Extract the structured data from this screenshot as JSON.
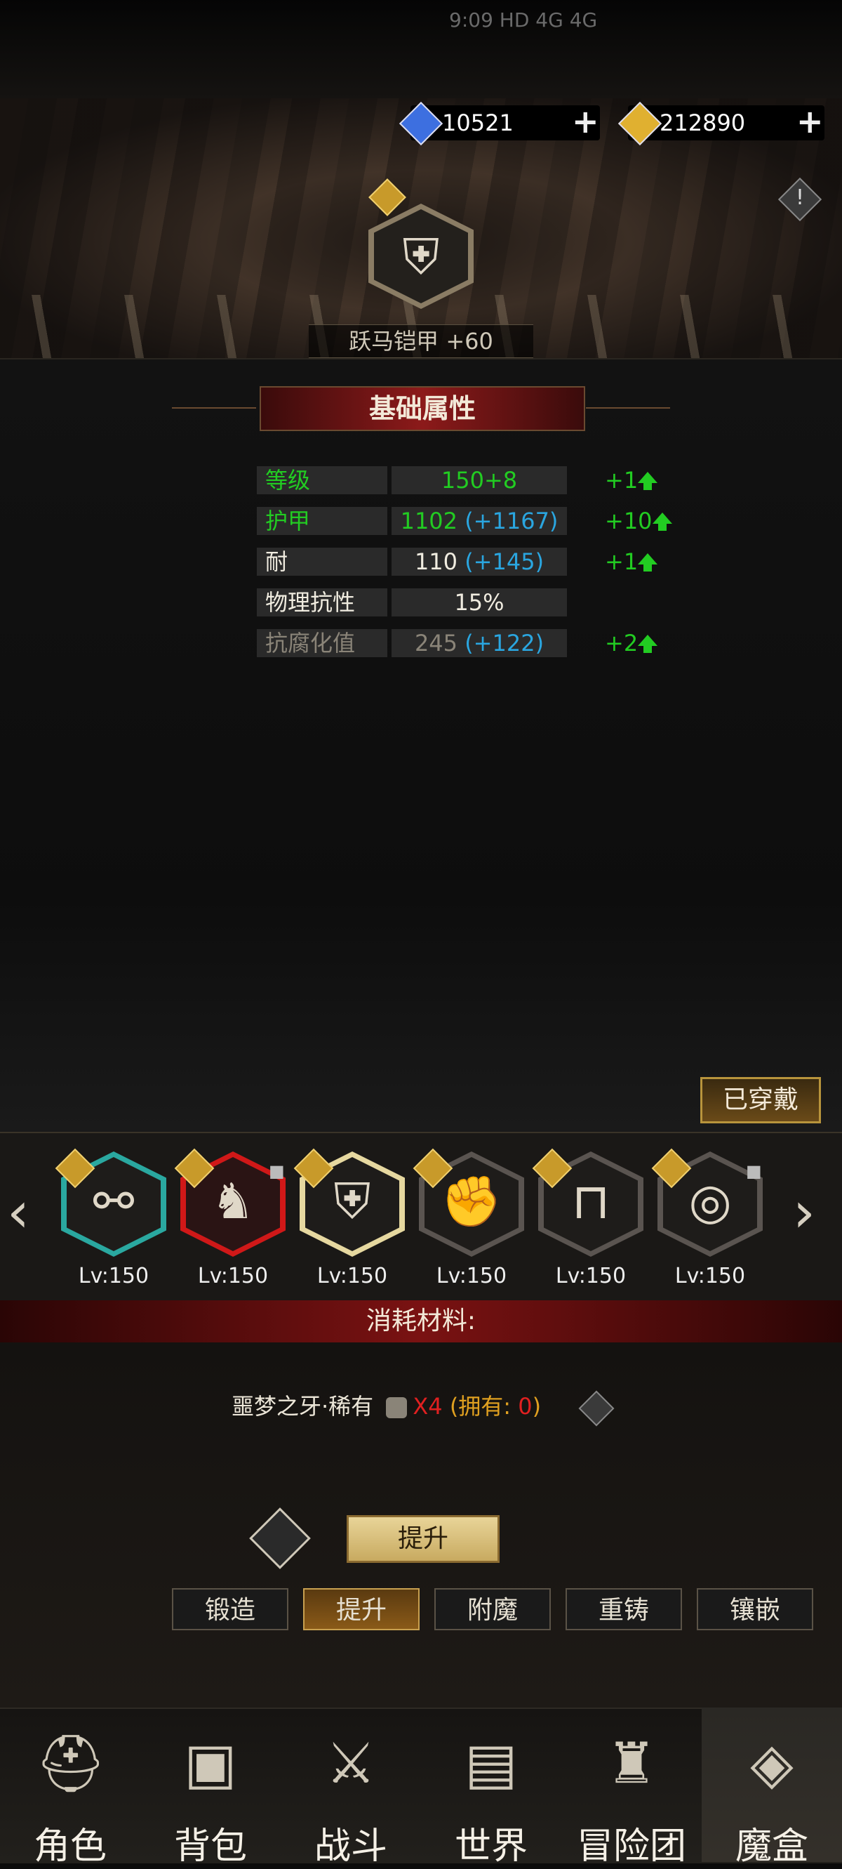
{
  "status_bar": {
    "text": "9:09 HD 4G 4G"
  },
  "currency": {
    "diamonds": "10521",
    "gold": "212890",
    "plus_label": "+",
    "diamond_color": "#3d6fe0",
    "gold_color": "#e0b030"
  },
  "item": {
    "name": "跃马铠甲 +60",
    "info_icon": "!"
  },
  "attributes": {
    "title": "基础属性",
    "rows": [
      {
        "name": "等级",
        "value": "150+8",
        "bonus": "",
        "gain": "+1"
      },
      {
        "name": "护甲",
        "value": "1102",
        "bonus": "(+1167)",
        "gain": "+10"
      },
      {
        "name": "耐",
        "value": "110",
        "bonus": "(+145)",
        "gain": "+1"
      },
      {
        "name": "物理抗性",
        "value": "15%",
        "bonus": "",
        "gain": ""
      },
      {
        "name": "抗腐化值",
        "value": "245",
        "bonus": "(+122)",
        "gain": "+2"
      }
    ]
  },
  "equipped_button": "已穿戴",
  "equipment": {
    "left_arrow": "‹",
    "right_arrow": "›",
    "slots": [
      {
        "level": "Lv:150",
        "icon": "bracer-icon",
        "frame": "teal"
      },
      {
        "level": "Lv:150",
        "icon": "bear-head-icon",
        "frame": "red"
      },
      {
        "level": "Lv:150",
        "icon": "armor-icon",
        "frame": "gold-selected"
      },
      {
        "level": "Lv:150",
        "icon": "gauntlet-icon",
        "frame": "grey"
      },
      {
        "level": "Lv:150",
        "icon": "boots-icon",
        "frame": "grey"
      },
      {
        "level": "Lv:150",
        "icon": "ring-icon",
        "frame": "grey"
      }
    ]
  },
  "consume": {
    "title": "消耗材料:",
    "material_name": "噩梦之牙·稀有",
    "quantity": "X4",
    "owned_label": "(拥有: ",
    "owned_count": "0",
    "owned_close": ")"
  },
  "upgrade_button": "提升",
  "tabs": [
    {
      "label": "锻造",
      "active": false
    },
    {
      "label": "提升",
      "active": true
    },
    {
      "label": "附魔",
      "active": false
    },
    {
      "label": "重铸",
      "active": false
    },
    {
      "label": "镶嵌",
      "active": false
    }
  ],
  "bottom_nav": [
    {
      "label": "角色",
      "icon": "helmet-icon"
    },
    {
      "label": "背包",
      "icon": "backpack-icon"
    },
    {
      "label": "战斗",
      "icon": "sword-shield-icon"
    },
    {
      "label": "世界",
      "icon": "map-icon"
    },
    {
      "label": "冒险团",
      "icon": "castle-icon"
    },
    {
      "label": "魔盒",
      "icon": "magic-box-icon"
    }
  ]
}
